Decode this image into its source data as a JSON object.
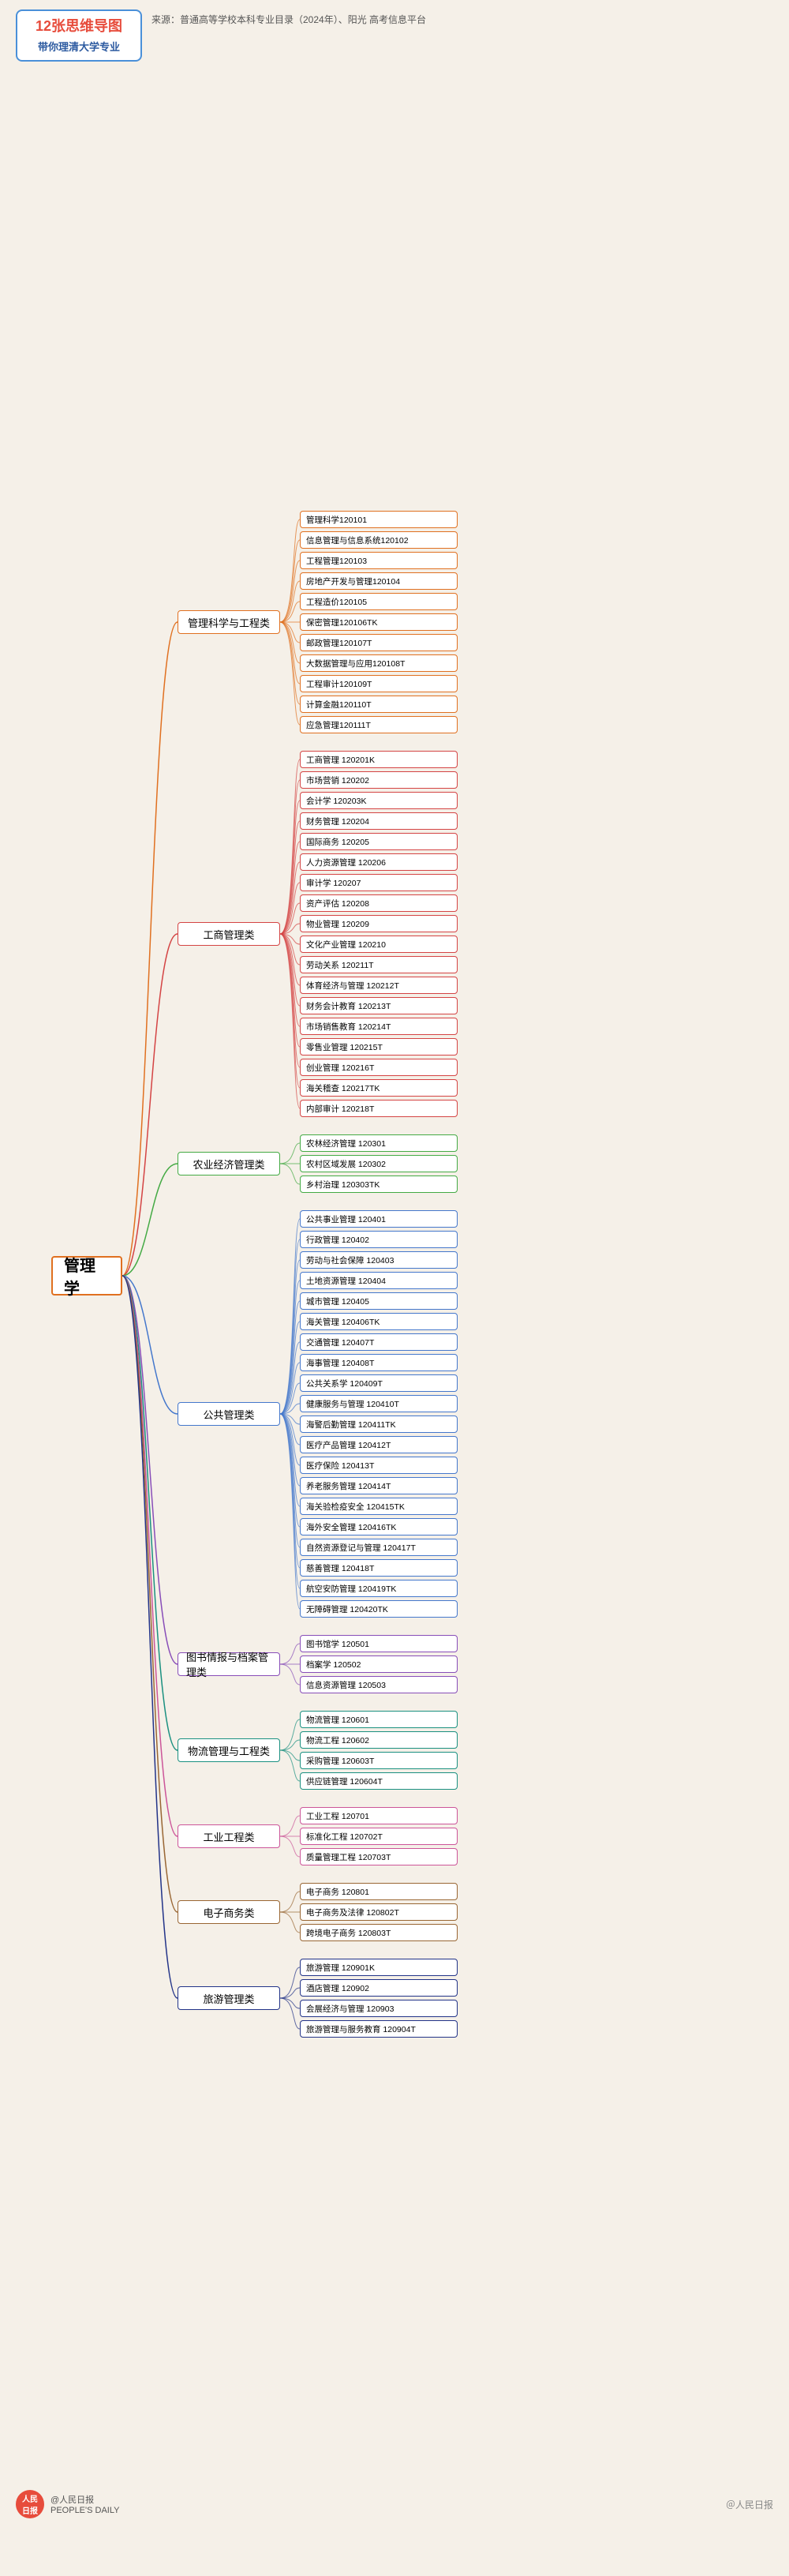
{
  "header": {
    "badge_title": "12张思维导图",
    "badge_subtitle": "带你理清大学专业",
    "source_text": "来源：普通高等学校本科专业目录（2024年）、阳光\n高考信息平台"
  },
  "footer": {
    "logo_text": "@人民日报\nPEOPLE'S DAILY",
    "watermark": "＠人民日报"
  },
  "center": {
    "label": "管理学"
  },
  "categories": [
    {
      "id": "cat1",
      "label": "管理科学与工程类",
      "color": "orange",
      "leaves": [
        "管理科学120101",
        "信息管理与信息系统120102",
        "工程管理120103",
        "房地产开发与管理120104",
        "工程造价120105",
        "保密管理120106TK",
        "邮政管理120107T",
        "大数据管理与应用120108T",
        "工程审计120109T",
        "计算金融120110T",
        "应急管理120111T"
      ]
    },
    {
      "id": "cat2",
      "label": "工商管理类",
      "color": "red",
      "leaves": [
        "工商管理 120201K",
        "市场营销 120202",
        "会计学 120203K",
        "财务管理 120204",
        "国际商务 120205",
        "人力资源管理 120206",
        "审计学 120207",
        "资产评估 120208",
        "物业管理 120209",
        "文化产业管理 120210",
        "劳动关系 120211T",
        "体育经济与管理 120212T",
        "财务会计教育 120213T",
        "市场销售教育 120214T",
        "零售业管理 120215T",
        "创业管理 120216T",
        "海关稽查 120217TK",
        "内部审计 120218T"
      ]
    },
    {
      "id": "cat3",
      "label": "农业经济管理类",
      "color": "green",
      "leaves": [
        "农林经济管理 120301",
        "农村区域发展 120302",
        "乡村治理 120303TK"
      ]
    },
    {
      "id": "cat4",
      "label": "公共管理类",
      "color": "blue",
      "leaves": [
        "公共事业管理 120401",
        "行政管理 120402",
        "劳动与社会保障 120403",
        "土地资源管理 120404",
        "城市管理 120405",
        "海关管理 120406TK",
        "交通管理 120407T",
        "海事管理 120408T",
        "公共关系学 120409T",
        "健康服务与管理 120410T",
        "海警后勤管理 120411TK",
        "医疗产品管理 120412T",
        "医疗保险 120413T",
        "养老服务管理 120414T",
        "海关验检疫安全 120415TK",
        "海外安全管理 120416TK",
        "自然资源登记与管理 120417T",
        "慈善管理 120418T",
        "航空安防管理 120419TK",
        "无障碍管理 120420TK"
      ]
    },
    {
      "id": "cat5",
      "label": "图书情报与档案管理类",
      "color": "purple",
      "leaves": [
        "图书馆学 120501",
        "档案学 120502",
        "信息资源管理 120503"
      ]
    },
    {
      "id": "cat6",
      "label": "物流管理与工程类",
      "color": "teal",
      "leaves": [
        "物流管理 120601",
        "物流工程 120602",
        "采购管理 120603T",
        "供应链管理 120604T"
      ]
    },
    {
      "id": "cat7",
      "label": "工业工程类",
      "color": "pink",
      "leaves": [
        "工业工程 120701",
        "标准化工程 120702T",
        "质量管理工程 120703T"
      ]
    },
    {
      "id": "cat8",
      "label": "电子商务类",
      "color": "brown",
      "leaves": [
        "电子商务 120801",
        "电子商务及法律 120802T",
        "跨境电子商务 120803T"
      ]
    },
    {
      "id": "cat9",
      "label": "旅游管理类",
      "color": "darkblue",
      "leaves": [
        "旅游管理 120901K",
        "酒店管理 120902",
        "会展经济与管理 120903",
        "旅游管理与服务教育 120904T"
      ]
    }
  ]
}
